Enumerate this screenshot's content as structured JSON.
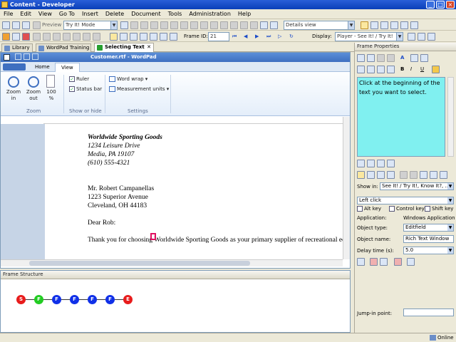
{
  "window": {
    "title": "Content - Developer"
  },
  "menu": [
    "File",
    "Edit",
    "View",
    "Go To",
    "Insert",
    "Delete",
    "Document",
    "Tools",
    "Administration",
    "Help"
  ],
  "toolbar1": {
    "preview_label": "Preview",
    "mode_value": "Try It! Mode",
    "view_value": "Details view"
  },
  "toolbar2": {
    "frame_id_label": "Frame ID:",
    "frame_id_value": "21",
    "display_label": "Display:",
    "display_value": "Player - See It! / Try It!"
  },
  "tabs": [
    {
      "label": "Library"
    },
    {
      "label": "WordPad Training"
    },
    {
      "label": "Selecting Text"
    }
  ],
  "wordpad": {
    "title": "Customer.rtf - WordPad",
    "ribbon_tabs": [
      "Home",
      "View"
    ],
    "zoom_in": "Zoom in",
    "zoom_out": "Zoom out",
    "hundred": "100 %",
    "group_zoom": "Zoom",
    "ruler": "Ruler",
    "status_bar": "Status bar",
    "group_show": "Show or hide",
    "word_wrap": "Word wrap",
    "measurement_units": "Measurement units",
    "group_settings": "Settings"
  },
  "document_lines": [
    {
      "text": "Worldwide Sporting Goods",
      "style": "bi"
    },
    {
      "text": "1234 Leisure Drive",
      "style": "i"
    },
    {
      "text": "Media, PA 19107",
      "style": "i"
    },
    {
      "text": "(610) 555-4321",
      "style": "i"
    },
    {
      "text": "",
      "style": ""
    },
    {
      "text": "",
      "style": ""
    },
    {
      "text": "Mr. Robert Campanellas",
      "style": ""
    },
    {
      "text": "1223 Superior Avenue",
      "style": ""
    },
    {
      "text": "Cleveland, OH  44183",
      "style": ""
    },
    {
      "text": "",
      "style": ""
    },
    {
      "text": "Dear Rob:",
      "style": ""
    },
    {
      "text": "",
      "style": ""
    },
    {
      "text": "Thank you for choosing Worldwide Sporting Goods as your primary supplier of recreational eq",
      "style": ""
    }
  ],
  "frame_structure": {
    "title": "Frame Structure",
    "nodes": [
      {
        "label": "S",
        "color": "#e81c1c"
      },
      {
        "label": "F",
        "color": "#22cc22"
      },
      {
        "label": "F",
        "color": "#1030e8"
      },
      {
        "label": "F",
        "color": "#1030e8"
      },
      {
        "label": "F",
        "color": "#1030e8"
      },
      {
        "label": "F",
        "color": "#1030e8"
      },
      {
        "label": "E",
        "color": "#e81c1c"
      }
    ]
  },
  "frame_properties": {
    "title": "Frame Properties",
    "bubble_text": "Click at the beginning of the text you want to select.",
    "show_in_label": "Show in:",
    "show_in_value": "See It! / Try It!, Know It?, ...",
    "action_value": "Left click",
    "alt_key": "Alt key",
    "control_key": "Control key",
    "shift_key": "Shift key",
    "application_label": "Application:",
    "application_value": "Windows Application",
    "object_type_label": "Object type:",
    "object_type_value": "Editfield",
    "object_name_label": "Object name:",
    "object_name_value": "Rich Text Window",
    "delay_label": "Delay time (s):",
    "delay_value": "5.0",
    "jump_in_label": "Jump-in point:"
  },
  "status": {
    "online": "Online"
  },
  "colors": {
    "bubble": "#80f0f0",
    "accent": "#3e6fc0"
  }
}
